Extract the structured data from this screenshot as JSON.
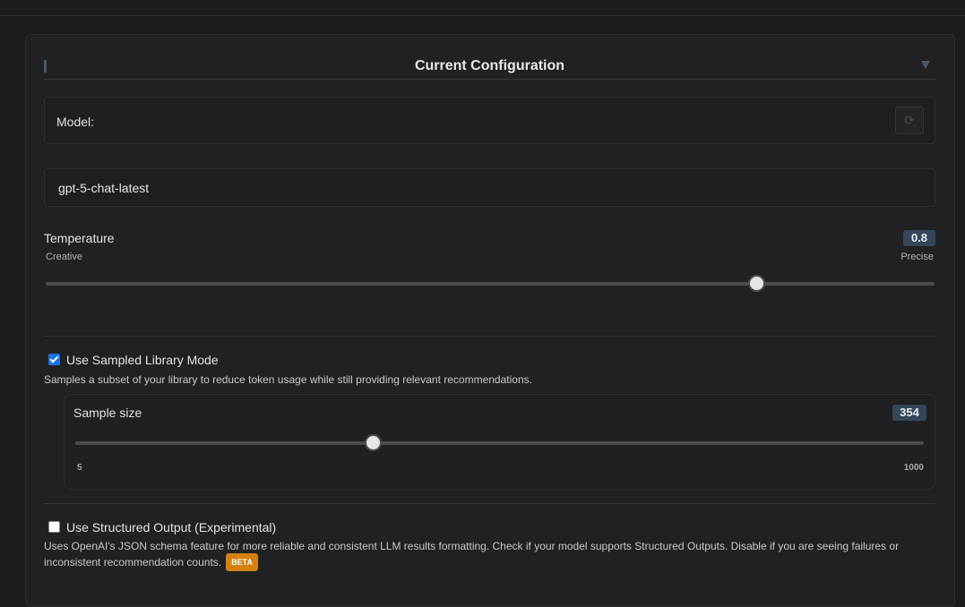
{
  "header": {
    "title": "Current Configuration"
  },
  "model": {
    "label": "Model:",
    "refresh_icon": "⟳",
    "value": "gpt-5-chat-latest"
  },
  "temperature": {
    "label": "Temperature",
    "value": "0.8",
    "min_label": "Creative",
    "max_label": "Precise",
    "fraction": 0.8
  },
  "sampled_mode": {
    "label": "Use Sampled Library Mode",
    "checked": true,
    "description": "Samples a subset of your library to reduce token usage while still providing relevant recommendations."
  },
  "sample_size": {
    "label": "Sample size",
    "value": "354",
    "min": "5",
    "max": "1000",
    "fraction": 0.351
  },
  "structured_output": {
    "label": "Use Structured Output (Experimental)",
    "checked": false,
    "description": "Uses OpenAI's JSON schema feature for more reliable and consistent LLM results formatting. Check if your model supports Structured Outputs. Disable if you are seeing failures or inconsistent recommendation counts.",
    "badge": "BETA"
  },
  "colors": {
    "accent": "#354659",
    "checkbox": "#1a73e8",
    "beta": "#d4800f"
  }
}
